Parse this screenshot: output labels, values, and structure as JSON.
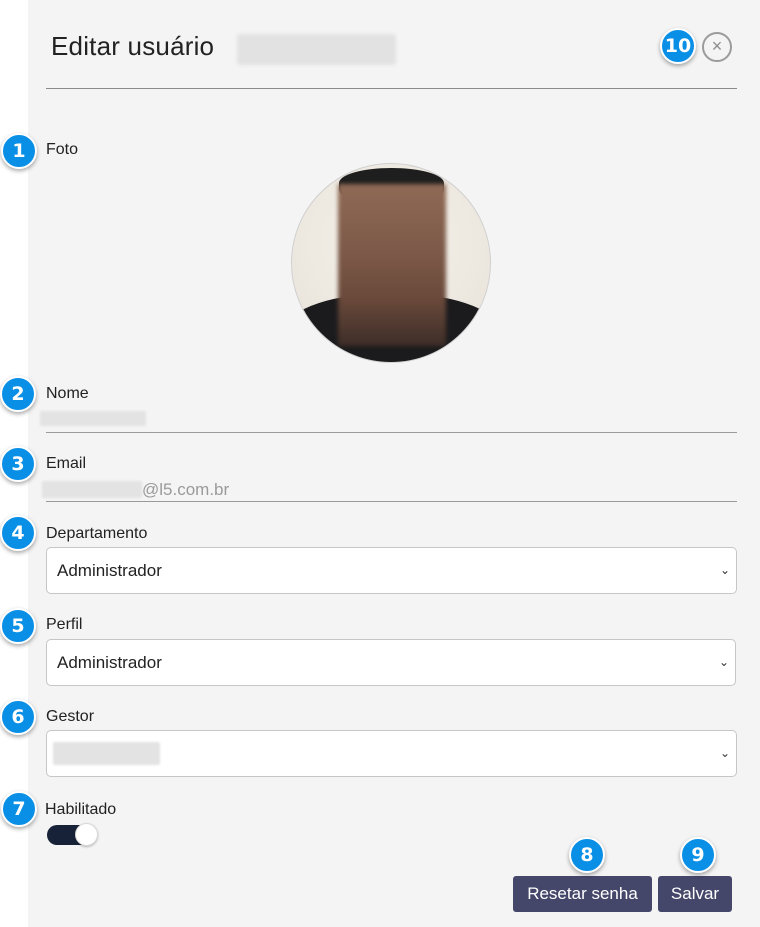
{
  "dialog": {
    "title": "Editar usuário",
    "close_icon": "close-icon",
    "close_glyph": "×"
  },
  "form": {
    "photo_label": "Foto",
    "name_label": "Nome",
    "email_label": "Email",
    "email_domain": "@l5.com.br",
    "department_label": "Departamento",
    "department_value": "Administrador",
    "profile_label": "Perfil",
    "profile_value": "Administrador",
    "manager_label": "Gestor",
    "enabled_label": "Habilitado",
    "enabled": true,
    "chevron_glyph": "⌄"
  },
  "actions": {
    "reset_password_label": "Resetar senha",
    "save_label": "Salvar"
  },
  "markers": [
    "1",
    "2",
    "3",
    "4",
    "5",
    "6",
    "7",
    "8",
    "9",
    "10"
  ],
  "colors": {
    "panel_bg": "#f4f4f4",
    "button_bg": "#45476a",
    "toggle_on": "#172238",
    "marker_bg": "#0a8fe6"
  }
}
